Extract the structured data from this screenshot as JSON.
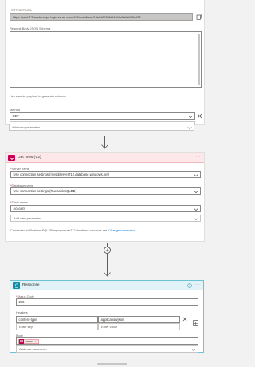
{
  "http_trigger": {
    "url_label": "HTTP GET URL",
    "url_value": "https://prod-17.westeurope.logic.azure.com:443/workflows/1de0d6286fd54c6ba5e6a928cd33",
    "schema_label": "Request Body JSON Schema",
    "sample_link": "Use sample payload to generate schema",
    "method_label": "Method",
    "method_value": "GET",
    "add_param_placeholder": "Add new parameter"
  },
  "get_rows": {
    "title": "Get rows (V2)",
    "server_label": "Server name",
    "server_value": "Use connection settings (mysqlserver712.database.windows.net)",
    "database_label": "Database name",
    "database_value": "Use connection settings (RuebankSQLDB)",
    "table_label": "Table name",
    "table_value": "Account",
    "add_param_placeholder": "Add new parameter",
    "connected_text": "Connected to RuebankSQLDB.mysqlserver712.database.windows.net.",
    "change_connection": "Change connection."
  },
  "response": {
    "title": "Response",
    "status_label": "Status Code",
    "status_value": "200",
    "headers_label": "Headers",
    "header_key": "content-type",
    "header_value": "application/json",
    "key_placeholder": "Enter key",
    "value_placeholder": "Enter value",
    "body_label": "Body",
    "body_token": "value",
    "add_param_placeholder": "Add new parameter"
  },
  "icons": {
    "copy": "copy-icon",
    "clear": "close-icon",
    "sql": "sql-server-icon",
    "response": "response-icon",
    "info": "info-icon",
    "insert": "plus-circle-icon",
    "chevron": "chevron-down-icon",
    "table_toggle": "table-mode-icon"
  },
  "colors": {
    "sql_accent": "#c30052",
    "response_accent": "#0f8fa7",
    "link": "#0078d4"
  }
}
